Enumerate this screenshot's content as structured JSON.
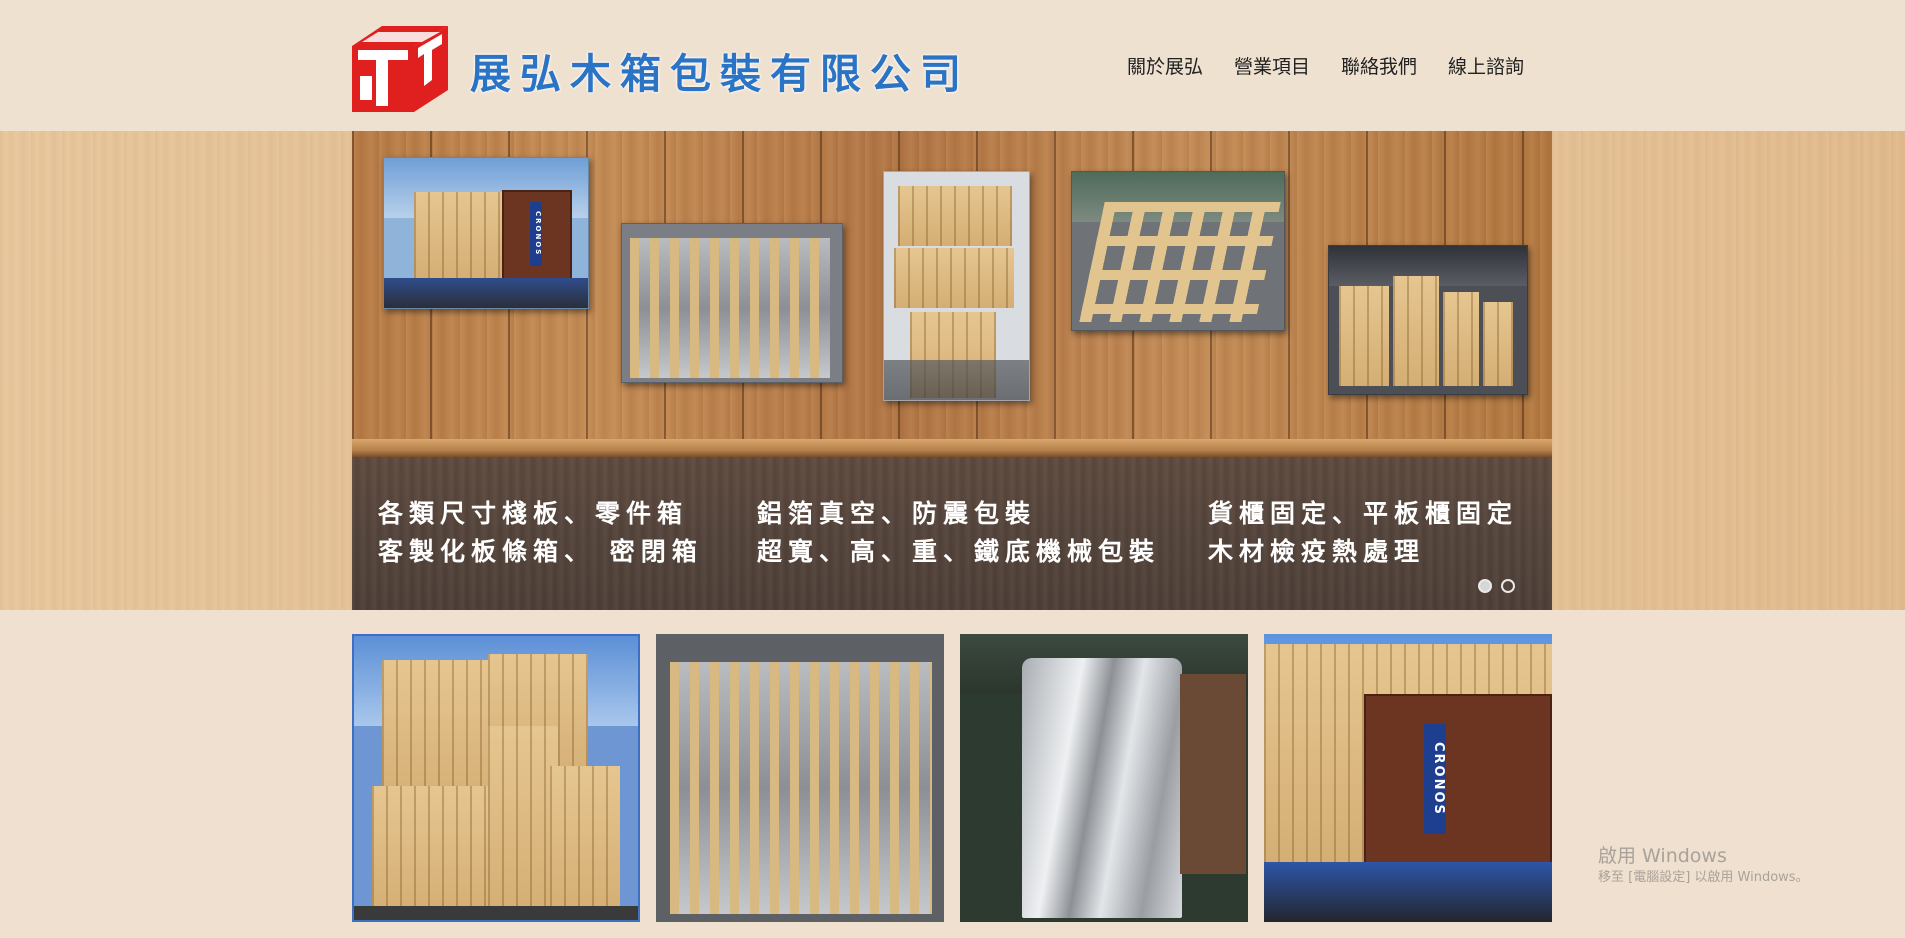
{
  "header": {
    "company_name": "展弘木箱包裝有限公司",
    "nav": [
      {
        "label": "關於展弘"
      },
      {
        "label": "營業項目"
      },
      {
        "label": "聯絡我們"
      },
      {
        "label": "線上諮詢"
      }
    ]
  },
  "slider": {
    "captions": [
      {
        "line1": "各類尺寸棧板、零件箱",
        "line2": "客製化板條箱、 密閉箱"
      },
      {
        "line1": "鋁箔真空、防震包裝",
        "line2": "超寬、高、重、鐵底機械包裝"
      },
      {
        "line1": "貨櫃固定、平板櫃固定",
        "line2": "木材檢疫熱處理"
      }
    ],
    "photo_container_label": "CRONOS",
    "slide_count": 2,
    "active_slide": 1
  },
  "gallery": {
    "thumb_container_label": "CRONOS",
    "selected_index": 0
  },
  "watermark": {
    "line1": "啟用 Windows",
    "line2": "移至 [電腦設定] 以啟用 Windows。"
  },
  "colors": {
    "background": "#efe0cf",
    "brand_blue": "#2b73c4",
    "logo_red": "#e0201f",
    "caption_bar": "#54443b"
  }
}
